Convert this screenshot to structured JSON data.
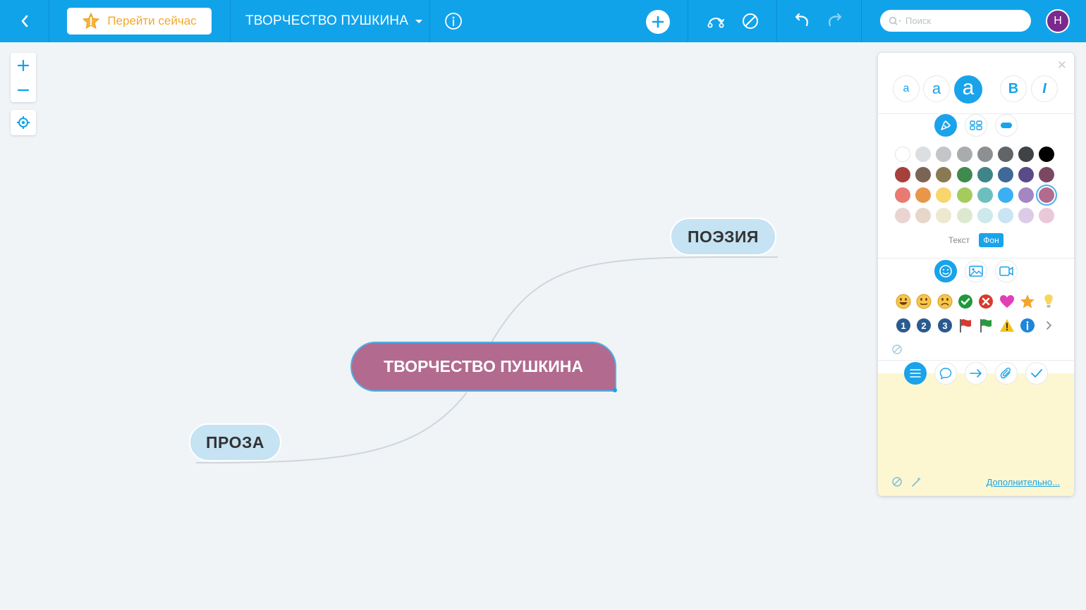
{
  "topbar": {
    "upgrade_label": "Перейти сейчас",
    "map_title": "ТВОРЧЕСТВО ПУШКИНА",
    "search_placeholder": "Поиск",
    "avatar_initial": "Н",
    "icons": [
      "back-icon",
      "star-icon",
      "caret-down-icon",
      "info-icon",
      "plus-icon",
      "connection-icon",
      "no-style-icon",
      "undo-icon",
      "redo-icon",
      "search-icon"
    ]
  },
  "zoom": {
    "icons": [
      "zoom-in-icon",
      "zoom-out-icon",
      "center-map-icon"
    ]
  },
  "mindmap": {
    "root": {
      "label": "ТВОРЧЕСТВО ПУШКИНА",
      "color": "#b26a8f"
    },
    "children": [
      {
        "label": "ПОЭЗИЯ",
        "color": "#c5e3f3"
      },
      {
        "label": "ПРОЗА",
        "color": "#c5e3f3"
      }
    ],
    "line_color": "#cfd6db"
  },
  "panel": {
    "font_size_labels": [
      "a",
      "a",
      "a"
    ],
    "bold_label": "B",
    "italic_label": "I",
    "palette": [
      [
        "#ffffff",
        "#dcdfe1",
        "#c3c6c8",
        "#a9acae",
        "#8d9092",
        "#626567",
        "#404346",
        "#000000"
      ],
      [
        "#a6403d",
        "#7b6455",
        "#8a7a53",
        "#3f8a4d",
        "#3f8588",
        "#3f6a98",
        "#5b4a88",
        "#7a4863"
      ],
      [
        "#e87a72",
        "#e8974a",
        "#f8d66d",
        "#a4cc5d",
        "#6dbfbe",
        "#3ab0f3",
        "#a486c2",
        "#b26a8f"
      ],
      [
        "#ead4d2",
        "#e7d6c9",
        "#ede8cf",
        "#dde9cf",
        "#cde9eb",
        "#cbe4f3",
        "#dccbe8",
        "#ebc8d8"
      ]
    ],
    "selected_color": "#b26a8f",
    "text_toggle_label": "Текст",
    "bg_toggle_label": "Фон",
    "icon_tabs": [
      "emoji-tab-icon",
      "image-tab-icon",
      "video-tab-icon"
    ],
    "emoji_row1": [
      "smile-icon",
      "neutral-icon",
      "sad-icon",
      "check-icon",
      "cross-icon",
      "heart-icon",
      "star-icon",
      "bulb-icon"
    ],
    "emoji_row2": [
      "number-1",
      "number-2",
      "number-3",
      "red-flag-icon",
      "green-flag-icon",
      "warning-icon",
      "info-icon",
      "next-arrow-icon"
    ],
    "number_labels": [
      "1",
      "2",
      "3"
    ],
    "bottom_tabs": [
      "notes-icon",
      "comment-icon",
      "link-icon",
      "attachment-icon",
      "task-icon"
    ],
    "more_label": "Дополнительно..."
  }
}
